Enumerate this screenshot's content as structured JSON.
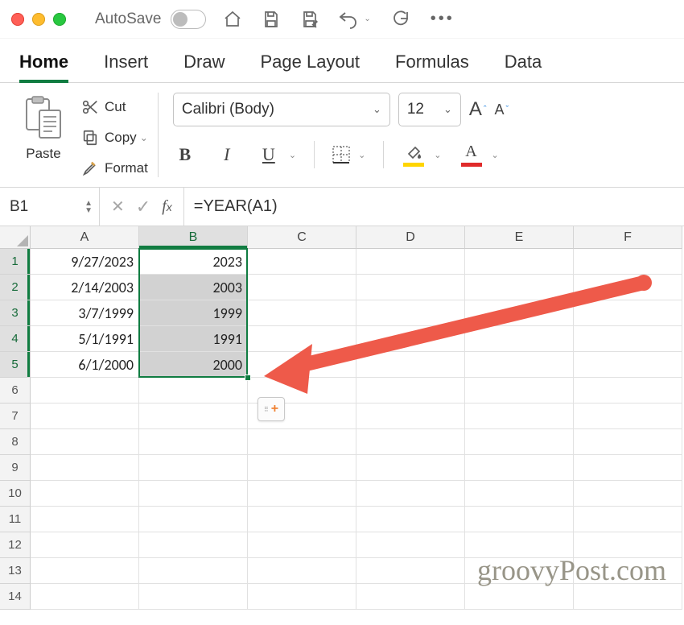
{
  "titlebar": {
    "autosave_label": "AutoSave"
  },
  "tabs": [
    "Home",
    "Insert",
    "Draw",
    "Page Layout",
    "Formulas",
    "Data"
  ],
  "active_tab": 0,
  "clipboard": {
    "paste_label": "Paste",
    "cut_label": "Cut",
    "copy_label": "Copy",
    "format_label": "Format"
  },
  "font": {
    "name": "Calibri (Body)",
    "size": "12"
  },
  "formula_bar": {
    "cell_ref": "B1",
    "formula": "=YEAR(A1)"
  },
  "columns": [
    "A",
    "B",
    "C",
    "D",
    "E",
    "F"
  ],
  "selected_col_index": 1,
  "row_count": 14,
  "selected_rows": [
    1,
    2,
    3,
    4,
    5
  ],
  "cells": {
    "A": [
      "9/27/2023",
      "2/14/2003",
      "3/7/1999",
      "5/1/1991",
      "6/1/2000"
    ],
    "B": [
      "2023",
      "2003",
      "1999",
      "1991",
      "2000"
    ]
  },
  "watermark": "groovyPost.com"
}
